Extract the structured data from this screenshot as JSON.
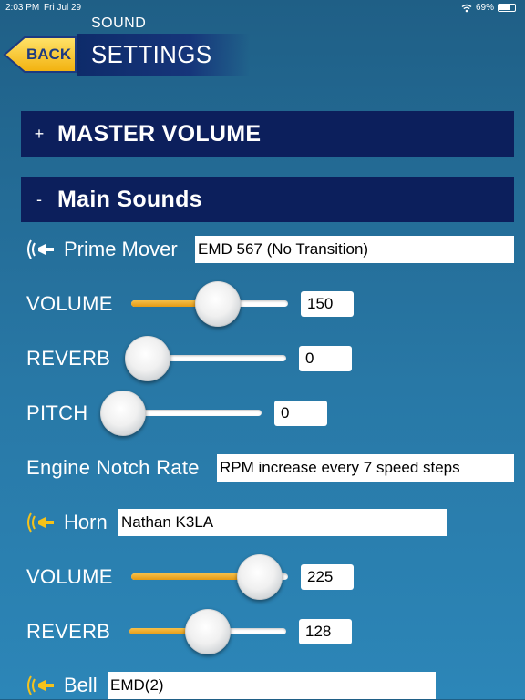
{
  "status": {
    "time": "2:03 PM",
    "date": "Fri Jul 29",
    "battery": "69%",
    "battery_level": 0.69
  },
  "header": {
    "back_label": "BACK",
    "subtitle": "SOUND",
    "title": "SETTINGS"
  },
  "sections": {
    "master_volume": {
      "sign": "+",
      "name": "MASTER VOLUME"
    },
    "main_sounds": {
      "sign": "-",
      "name": "Main Sounds"
    }
  },
  "prime_mover": {
    "label": "Prime Mover",
    "selection": "EMD 567 (No Transition)",
    "volume": {
      "label": "VOLUME",
      "value": "150",
      "fraction": 0.55
    },
    "reverb": {
      "label": "REVERB",
      "value": "0",
      "fraction": 0.0
    },
    "pitch": {
      "label": "PITCH",
      "value": "0",
      "fraction": 0.0
    },
    "notch": {
      "label": "Engine Notch Rate",
      "value": "RPM increase every 7 speed steps"
    }
  },
  "horn": {
    "label": "Horn",
    "selection": "Nathan K3LA",
    "volume": {
      "label": "VOLUME",
      "value": "225",
      "fraction": 0.82
    },
    "reverb": {
      "label": "REVERB",
      "value": "128",
      "fraction": 0.5
    }
  },
  "bell": {
    "label": "Bell",
    "selection": "EMD(2)"
  },
  "colors": {
    "accent_orange": "#e59a14",
    "section_navy": "#0c1f5c",
    "back_yellow": "#f5c21b"
  },
  "icons": {
    "sound": "horn-sound-icon",
    "wifi": "wifi-icon",
    "battery": "battery-icon"
  }
}
